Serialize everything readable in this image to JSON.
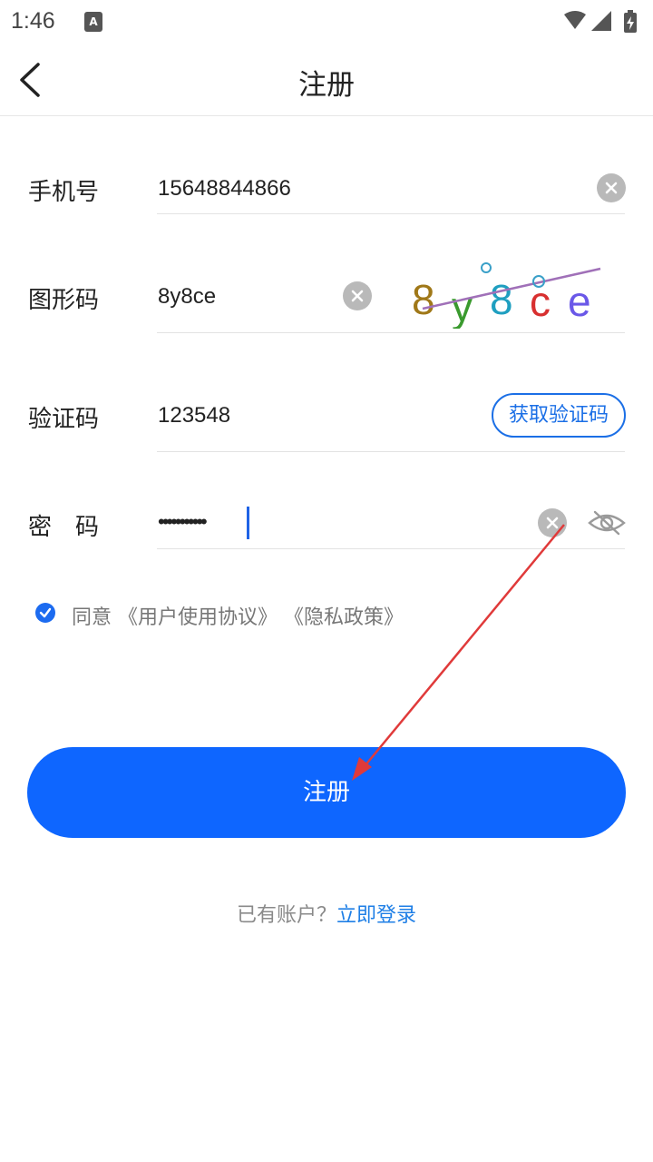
{
  "status_bar": {
    "time": "1:46",
    "icons": [
      "font-icon",
      "wifi-icon",
      "signal-icon",
      "battery-icon"
    ]
  },
  "header": {
    "title": "注册",
    "back_icon": "chevron-left-icon"
  },
  "form": {
    "phone": {
      "label": "手机号",
      "value": "15648844866"
    },
    "captcha": {
      "label": "图形码",
      "value": "8y8ce",
      "image_text": "8y8ce"
    },
    "sms_code": {
      "label": "验证码",
      "value": "123548",
      "button": "获取验证码"
    },
    "password": {
      "label": "密　码",
      "value": "•••••••••••"
    }
  },
  "agreement": {
    "checked": true,
    "prefix": "同意",
    "terms": "《用户使用协议》",
    "privacy": "《隐私政策》"
  },
  "submit_label": "注册",
  "login_prompt": {
    "question": "已有账户？",
    "link": "立即登录"
  },
  "colors": {
    "primary": "#0e66ff",
    "link": "#1f7fe6",
    "annotation": "#e03a3a"
  }
}
